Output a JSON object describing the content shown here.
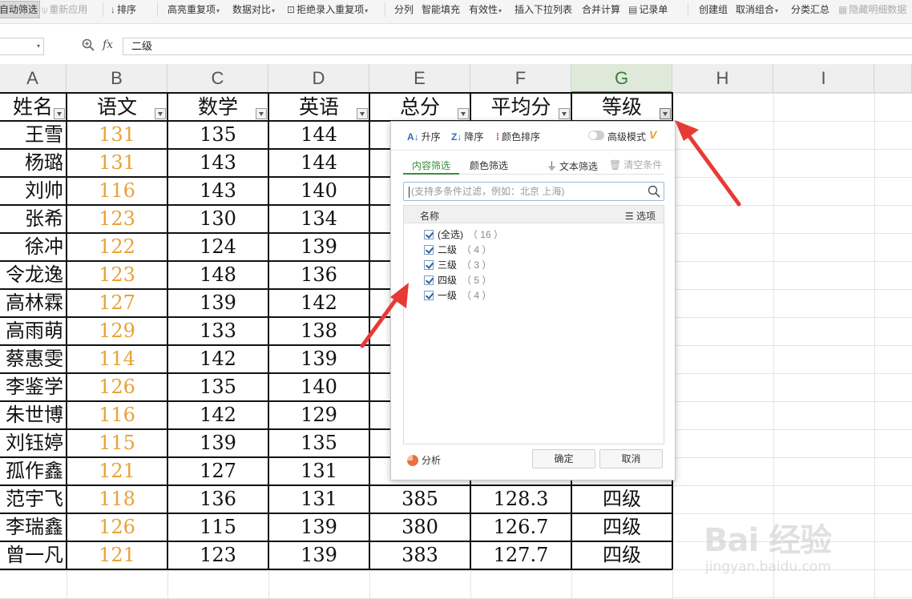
{
  "ribbon": {
    "auto_filter": "自动筛选",
    "reapply": "重新应用",
    "sort": "排序",
    "highlight_dup": "高亮重复项",
    "data_compare": "数据对比",
    "reject_dup": "拒绝录入重复项",
    "split_col": "分列",
    "smart_fill": "智能填充",
    "validity": "有效性",
    "insert_dropdown": "插入下拉列表",
    "merge_calc": "合并计算",
    "record_form": "记录单",
    "create_group": "创建组",
    "ungroup": "取消组合",
    "subtotal": "分类汇总",
    "hide_detail": "隐藏明细数据"
  },
  "formula_bar": {
    "fx": "fx",
    "value": "二级"
  },
  "columns": [
    "A",
    "B",
    "C",
    "D",
    "E",
    "F",
    "G",
    "H",
    "I"
  ],
  "headers": [
    "姓名",
    "语文",
    "数学",
    "英语",
    "总分",
    "平均分",
    "等级"
  ],
  "rows": [
    {
      "name": "王雪",
      "b": "131",
      "c": "135",
      "d": "144",
      "e": "",
      "f": "",
      "g": ""
    },
    {
      "name": "杨璐",
      "b": "131",
      "c": "143",
      "d": "144",
      "e": "",
      "f": "",
      "g": ""
    },
    {
      "name": "刘帅",
      "b": "116",
      "c": "143",
      "d": "140",
      "e": "",
      "f": "",
      "g": ""
    },
    {
      "name": "张希",
      "b": "123",
      "c": "130",
      "d": "134",
      "e": "",
      "f": "",
      "g": ""
    },
    {
      "name": "徐冲",
      "b": "122",
      "c": "124",
      "d": "139",
      "e": "",
      "f": "",
      "g": ""
    },
    {
      "name": "令龙逸",
      "b": "123",
      "c": "148",
      "d": "136",
      "e": "",
      "f": "",
      "g": ""
    },
    {
      "name": "高林霖",
      "b": "127",
      "c": "139",
      "d": "142",
      "e": "",
      "f": "",
      "g": ""
    },
    {
      "name": "高雨萌",
      "b": "129",
      "c": "133",
      "d": "138",
      "e": "",
      "f": "",
      "g": ""
    },
    {
      "name": "蔡惠雯",
      "b": "114",
      "c": "142",
      "d": "139",
      "e": "",
      "f": "",
      "g": ""
    },
    {
      "name": "李鉴学",
      "b": "126",
      "c": "135",
      "d": "140",
      "e": "",
      "f": "",
      "g": ""
    },
    {
      "name": "朱世博",
      "b": "116",
      "c": "142",
      "d": "129",
      "e": "",
      "f": "",
      "g": ""
    },
    {
      "name": "刘钰婷",
      "b": "115",
      "c": "139",
      "d": "135",
      "e": "",
      "f": "",
      "g": ""
    },
    {
      "name": "孤作鑫",
      "b": "121",
      "c": "127",
      "d": "131",
      "e": "",
      "f": "",
      "g": ""
    },
    {
      "name": "范宇飞",
      "b": "118",
      "c": "136",
      "d": "131",
      "e": "385",
      "f": "128.3",
      "g": "四级"
    },
    {
      "name": "李瑞鑫",
      "b": "126",
      "c": "115",
      "d": "139",
      "e": "380",
      "f": "126.7",
      "g": "四级"
    },
    {
      "name": "曾一凡",
      "b": "121",
      "c": "123",
      "d": "139",
      "e": "383",
      "f": "127.7",
      "g": "四级"
    }
  ],
  "filter_popup": {
    "sort_asc": "升序",
    "sort_desc": "降序",
    "color_sort": "颜色排序",
    "advanced_mode": "高级模式",
    "tab_content": "内容筛选",
    "tab_color": "颜色筛选",
    "text_filter": "文本筛选",
    "clear_filter": "清空条件",
    "search_placeholder": "(支持多条件过滤，例如：北京  上海)",
    "list_header_name": "名称",
    "list_header_options": "选项",
    "items": [
      {
        "label": "(全选)",
        "count": "（ 16 ）",
        "checked": true
      },
      {
        "label": "二级",
        "count": "（ 4 ）",
        "checked": true
      },
      {
        "label": "三级",
        "count": "（ 3 ）",
        "checked": true
      },
      {
        "label": "四级",
        "count": "（ 5 ）",
        "checked": true
      },
      {
        "label": "一级",
        "count": "（ 4 ）",
        "checked": true
      }
    ],
    "analyze": "分析",
    "ok": "确定",
    "cancel": "取消"
  },
  "watermark": {
    "text": "Bai 经验",
    "sub": "jingyan.baidu.com"
  },
  "colors": {
    "accent_green": "#3a8e3a",
    "orange_values": "#e8a23a",
    "arrow_red": "#e83a35"
  }
}
